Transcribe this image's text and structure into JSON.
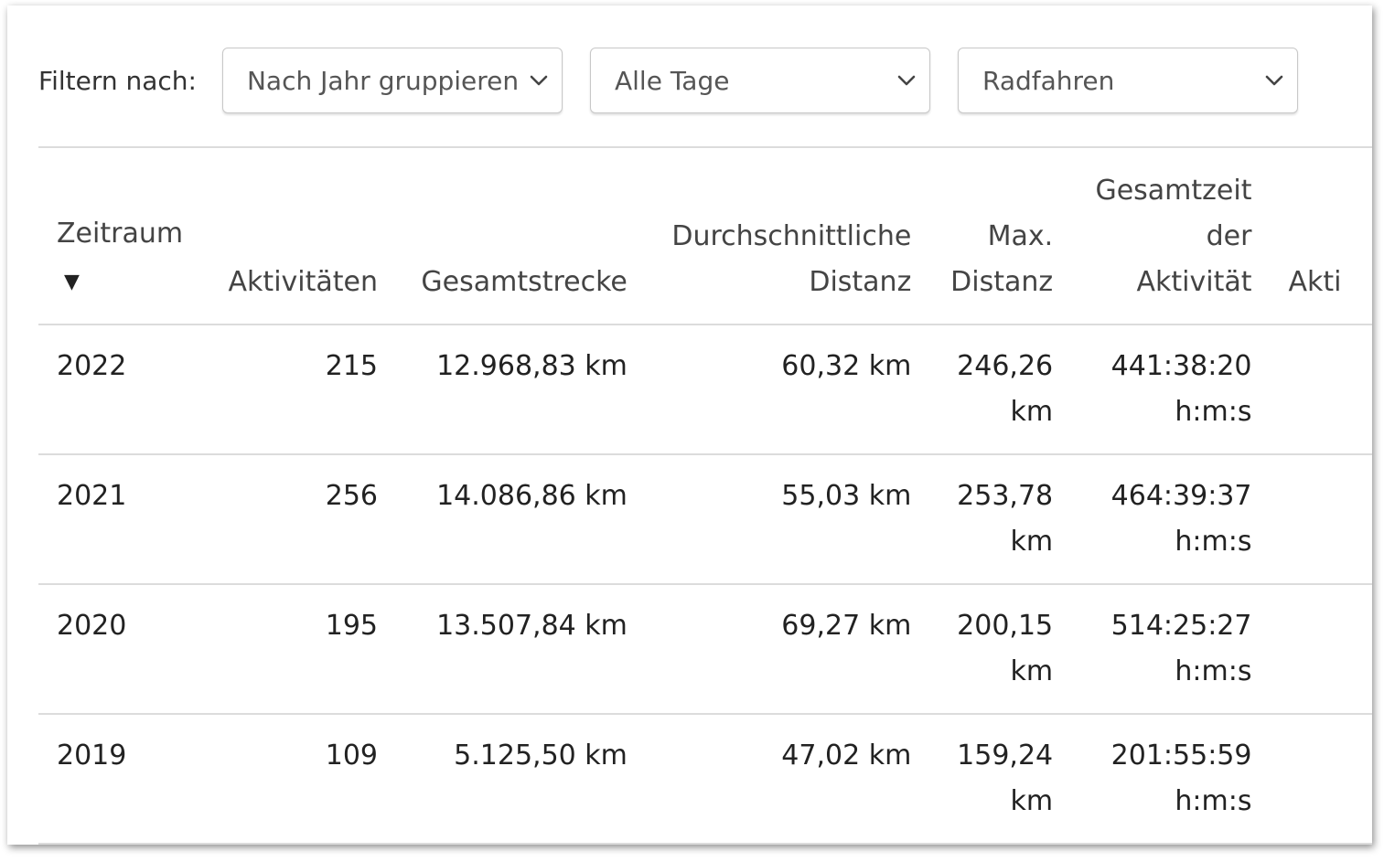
{
  "filter": {
    "label": "Filtern nach:",
    "group_by": "Nach Jahr gruppieren",
    "days": "Alle Tage",
    "sport": "Radfahren"
  },
  "table": {
    "headers": {
      "period": "Zeitraum",
      "period_sort": "▼",
      "activities": "Aktivitäten",
      "total_distance": "Gesamtstrecke",
      "avg_distance_1": "Durchschnittliche",
      "avg_distance_2": "Distanz",
      "max_distance_1": "Max.",
      "max_distance_2": "Distanz",
      "total_time_1": "Gesamtzeit",
      "total_time_2": "der",
      "total_time_3": "Aktivität",
      "truncated": "Akti"
    },
    "rows": [
      {
        "period": "2022",
        "activities": "215",
        "total_distance": "12.968,83 km",
        "avg_distance": "60,32 km",
        "max_distance_value": "246,26",
        "max_distance_unit": "km",
        "total_time_value": "441:38:20",
        "total_time_unit": "h:m:s"
      },
      {
        "period": "2021",
        "activities": "256",
        "total_distance": "14.086,86 km",
        "avg_distance": "55,03 km",
        "max_distance_value": "253,78",
        "max_distance_unit": "km",
        "total_time_value": "464:39:37",
        "total_time_unit": "h:m:s"
      },
      {
        "period": "2020",
        "activities": "195",
        "total_distance": "13.507,84 km",
        "avg_distance": "69,27 km",
        "max_distance_value": "200,15",
        "max_distance_unit": "km",
        "total_time_value": "514:25:27",
        "total_time_unit": "h:m:s"
      },
      {
        "period": "2019",
        "activities": "109",
        "total_distance": "5.125,50 km",
        "avg_distance": "47,02 km",
        "max_distance_value": "159,24",
        "max_distance_unit": "km",
        "total_time_value": "201:55:59",
        "total_time_unit": "h:m:s"
      }
    ]
  }
}
